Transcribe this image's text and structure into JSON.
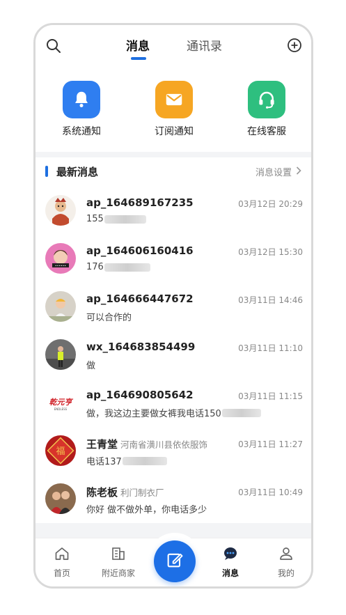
{
  "header": {
    "tabs": [
      {
        "label": "消息",
        "active": true
      },
      {
        "label": "通讯录",
        "active": false
      }
    ],
    "search_icon": "search-icon",
    "add_icon": "plus-circle-icon"
  },
  "quick_actions": [
    {
      "label": "系统通知",
      "icon": "bell-icon",
      "color": "#2f7ef0"
    },
    {
      "label": "订阅通知",
      "icon": "mail-icon",
      "color": "#f6a623"
    },
    {
      "label": "在线客服",
      "icon": "headset-icon",
      "color": "#2ebf7f"
    }
  ],
  "section": {
    "title": "最新消息",
    "link": "消息设置"
  },
  "messages": [
    {
      "name": "ap_164689167235",
      "company": "",
      "time": "03月12日 20:29",
      "preview": "155",
      "masked": true
    },
    {
      "name": "ap_164606160416",
      "company": "",
      "time": "03月12日 15:30",
      "preview": "176",
      "masked": true
    },
    {
      "name": "ap_164666447672",
      "company": "",
      "time": "03月11日 14:46",
      "preview": "可以合作的",
      "masked": false
    },
    {
      "name": "wx_164683854499",
      "company": "",
      "time": "03月11日 11:10",
      "preview": "做",
      "masked": false
    },
    {
      "name": "ap_164690805642",
      "company": "",
      "time": "03月11日 11:15",
      "preview": "做，我这边主要做女裤我电话150",
      "masked": true
    },
    {
      "name": "王青堂",
      "company": "河南省潢川县依依服饰",
      "time": "03月11日 11:27",
      "preview": "电话137",
      "masked": true
    },
    {
      "name": "陈老板",
      "company": "利门制衣厂",
      "time": "03月11日 10:49",
      "preview": "你好 做不做外单，你电话多少",
      "masked": false
    }
  ],
  "tabbar": {
    "items": [
      {
        "label": "首页",
        "icon": "home-icon"
      },
      {
        "label": "附近商家",
        "icon": "building-icon"
      },
      {
        "label": "消息",
        "icon": "chat-bubble-icon",
        "active": true
      },
      {
        "label": "我的",
        "icon": "user-icon"
      }
    ],
    "center_icon": "edit-icon",
    "accent": "#1d6fe6"
  }
}
